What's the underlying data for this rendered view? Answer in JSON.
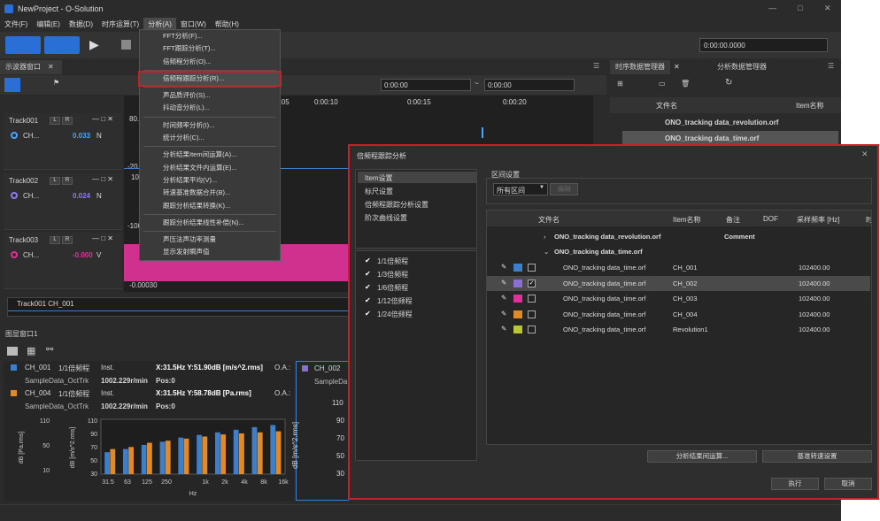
{
  "window": {
    "title": "NewProject - O-Solution",
    "controls": [
      "—",
      "□",
      "✕"
    ]
  },
  "menubar": [
    "文件(F)",
    "编辑(E)",
    "数据(D)",
    "时序运算(T)",
    "分析(A)",
    "窗口(W)",
    "帮助(H)"
  ],
  "toolbar": {
    "time": "0:00:00.0000"
  },
  "left_panel": {
    "tab": "示波器窗口",
    "time_from": "0:00:00",
    "time_to": "0:00:00",
    "axis_ticks": [
      "0:00:05",
      "0:00:10",
      "0:00:15",
      "0:00:20"
    ],
    "tracks": [
      {
        "name": "Track001",
        "channel": "CH...",
        "value": "0.033",
        "unit": "N",
        "value_color": "#4aa3ff",
        "ymax": "80.",
        "ymin": "-20."
      },
      {
        "name": "Track002",
        "channel": "CH...",
        "value": "0.024",
        "unit": "N",
        "value_color": "#8a7cf0",
        "ymax": "100",
        "ymin": "-100"
      },
      {
        "name": "Track003",
        "channel": "CH...",
        "value": "-0.000",
        "unit": "V",
        "value_color": "#e0309a",
        "ymax": "",
        "ymin": "-0.00030"
      }
    ],
    "overview_label": "Track001 CH_001",
    "lr_labels": [
      "L",
      "R"
    ]
  },
  "analysis_menu": {
    "items": [
      "FFT分析(F)...",
      "FFT跟踪分析(T)...",
      "倍频程分析(O)...",
      "倍频程跟踪分析(R)...",
      "声品质评价(S)...",
      "抖动音分析(L)...",
      "时间频率分析(I)...",
      "统计分析(C)...",
      "分析结果Item间运算(A)...",
      "分析结果文件内运算(E)...",
      "分析结果平均(V)...",
      "转速基准数据合并(B)...",
      "跟踪分析结果转换(K)...",
      "跟踪分析结果线性补偿(N)...",
      "声压法声功率测量",
      "显示发射瞬声值"
    ],
    "highlighted": 3
  },
  "graph_panel": {
    "tab": "图显窗口1",
    "entries": [
      {
        "ch": "CH_001",
        "type": "1/1倍频程",
        "mode": "Inst.",
        "reading": "X:31.5Hz Y:51.90dB [m/s^2.rms]",
        "oa": "O.A.:",
        "src": "SampleData_OctTrk",
        "rpm": "1002.229r/min",
        "pos": "Pos:0",
        "color": "#3d7fc9"
      },
      {
        "ch": "CH_004",
        "type": "1/1倍频程",
        "mode": "Inst.",
        "reading": "X:31.5Hz Y:58.78dB [Pa.rms]",
        "oa": "O.A.:",
        "src": "SampleData_OctTrk",
        "rpm": "1002.229r/min",
        "pos": "Pos:0",
        "color": "#e08a2a"
      }
    ],
    "y_label_left": "dB [Pa.rms]",
    "y_label_right": "dB [m/s^2.rms]",
    "yticks": [
      "110",
      "90",
      "70",
      "50",
      "30"
    ],
    "yticks_left": [
      "110",
      "50",
      "10"
    ],
    "x_label": "Hz",
    "xticks": [
      "31.5",
      "63",
      "125",
      "250",
      "1k",
      "2k",
      "4k",
      "8k",
      "16k"
    ]
  },
  "graph_panel2": {
    "ch": "CH_002",
    "src": "SampleDa",
    "ylabel": "dB [m/s^2.rms]",
    "yticks": [
      "110",
      "90",
      "70",
      "50",
      "30"
    ]
  },
  "right_panel": {
    "tabs": [
      "时序数据管理器",
      "分析数据管理器"
    ],
    "col_file": "文件名",
    "col_item": "Item名称",
    "files": [
      "ONO_tracking data_revolution.orf",
      "ONO_tracking data_time.orf"
    ]
  },
  "chart_data": {
    "type": "bar",
    "categories": [
      "31.5",
      "63",
      "125",
      "250",
      "500",
      "1k",
      "2k",
      "4k",
      "8k",
      "16k"
    ],
    "series": [
      {
        "values": [
          52,
          58,
          66,
          72,
          80,
          85,
          90,
          95,
          100,
          104
        ],
        "color": "#3d7fc9"
      },
      {
        "values": [
          58,
          62,
          70,
          74,
          78,
          82,
          86,
          88,
          90,
          92
        ],
        "color": "#e08a2a"
      }
    ],
    "ylim": [
      10,
      115
    ],
    "xlabel": "Hz"
  },
  "dialog": {
    "title": "倍频程跟踪分析",
    "nav": [
      "Item设置",
      "标尺设置",
      "倍频程跟踪分析设置",
      "阶次曲线设置"
    ],
    "section": "区间设置",
    "range_value": "所有区间",
    "range_btn": "编辑",
    "octaves": [
      "1/1倍频程",
      "1/3倍频程",
      "1/6倍频程",
      "1/12倍频程",
      "1/24倍频程"
    ],
    "columns": [
      "文件名",
      "Item名称",
      "备注",
      "DOF",
      "采样频率 [Hz]",
      "时"
    ],
    "groups": [
      {
        "name": "ONO_tracking data_revolution.orf",
        "comment": "Comment"
      },
      {
        "name": "ONO_tracking data_time.orf"
      }
    ],
    "rows": [
      {
        "file": "ONO_tracking data_time.orf",
        "item": "CH_001",
        "rate": "102400.00",
        "color": "#3d7fc9",
        "checked": false
      },
      {
        "file": "ONO_tracking data_time.orf",
        "item": "CH_002",
        "rate": "102400.00",
        "color": "#8a6fd0",
        "checked": true
      },
      {
        "file": "ONO_tracking data_time.orf",
        "item": "CH_003",
        "rate": "102400.00",
        "color": "#e0309a",
        "checked": false
      },
      {
        "file": "ONO_tracking data_time.orf",
        "item": "CH_004",
        "rate": "102400.00",
        "color": "#e08a2a",
        "checked": false
      },
      {
        "file": "ONO_tracking data_time.orf",
        "item": "Revolution1",
        "rate": "102400.00",
        "color": "#b9c830",
        "checked": false
      }
    ],
    "btn_calc": "分析结果间运算...",
    "btn_ref": "基准转速设置",
    "btn_ok": "执行",
    "btn_cancel": "取消"
  }
}
